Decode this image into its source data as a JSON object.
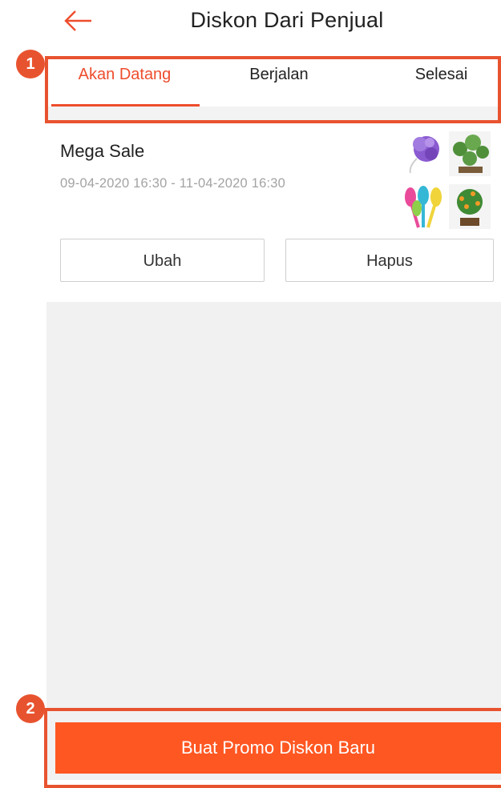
{
  "header": {
    "title": "Diskon Dari Penjual"
  },
  "tabs": [
    {
      "label": "Akan Datang",
      "active": true
    },
    {
      "label": "Berjalan",
      "active": false
    },
    {
      "label": "Selesai",
      "active": false
    }
  ],
  "promo": {
    "name": "Mega Sale",
    "dates": "09-04-2020 16:30 - 11-04-2020 16:30",
    "edit_label": "Ubah",
    "delete_label": "Hapus"
  },
  "create_button": {
    "label": "Buat Promo Diskon Baru"
  },
  "annotations": [
    {
      "number": "1"
    },
    {
      "number": "2"
    }
  ],
  "colors": {
    "accent": "#ee4d2d",
    "button": "#ff5722",
    "annotation": "#e8532f",
    "background": "#f1f1f1"
  }
}
